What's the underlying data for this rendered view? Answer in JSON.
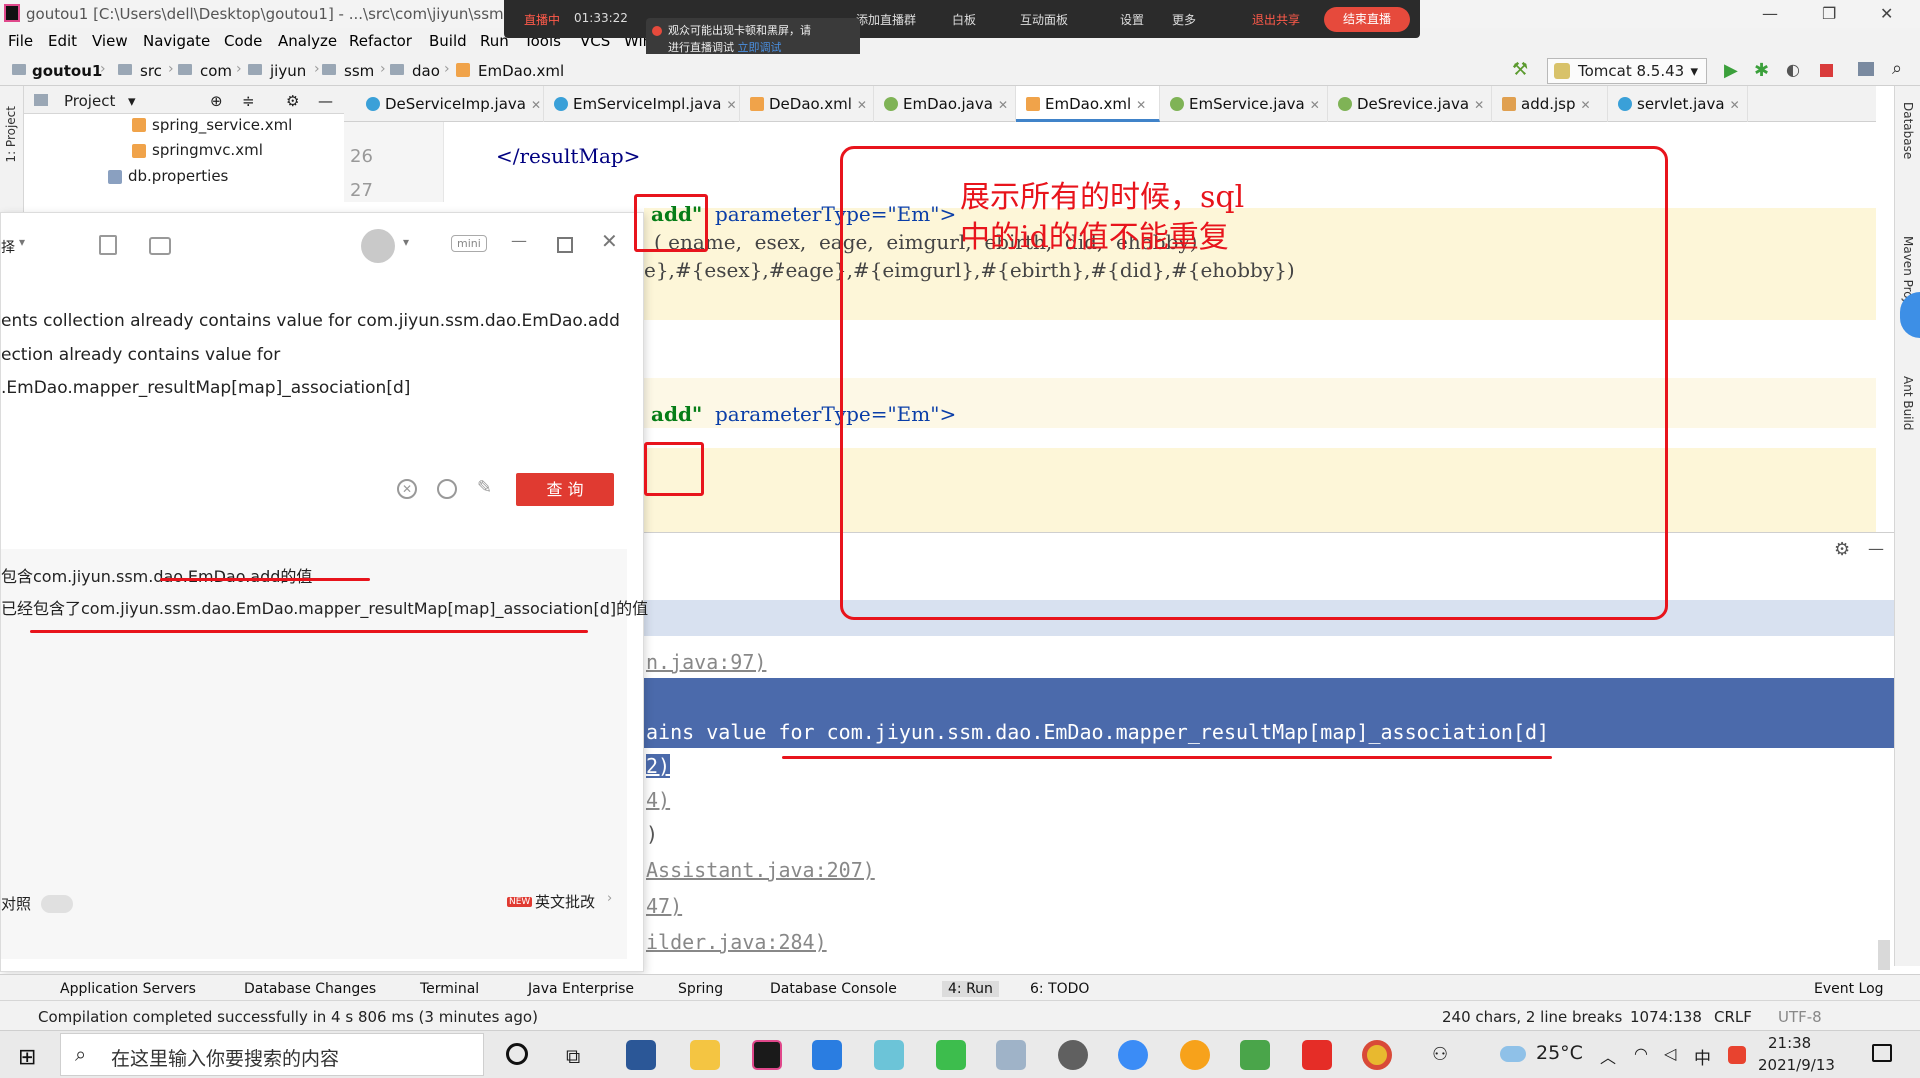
{
  "window": {
    "title": "goutou1 [C:\\Users\\dell\\Desktop\\goutou1] - ...\\src\\com\\jiyun\\ssm",
    "app_icon": "intellij-icon"
  },
  "live_bar": {
    "status": "直播中",
    "time": "01:33:22",
    "tip_line1": "观众可能出现卡顿和黑屏，请",
    "tip_line2": "进行直播调试",
    "tip_link": "立即调试",
    "items": [
      "添加直播群",
      "白板",
      "互动面板",
      "设置",
      "更多"
    ],
    "exit_share": "退出共享",
    "end_live": "结束直播"
  },
  "menu": [
    "File",
    "Edit",
    "View",
    "Navigate",
    "Code",
    "Analyze",
    "Refactor",
    "Build",
    "Run",
    "Tools",
    "VCS",
    "Window"
  ],
  "breadcrumb": [
    "goutou1",
    "src",
    "com",
    "jiyun",
    "ssm",
    "dao",
    "EmDao.xml"
  ],
  "run_config": "Tomcat 8.5.43",
  "project_panel": {
    "title": "Project",
    "items": [
      "spring_service.xml",
      "springmvc.xml",
      "db.properties"
    ]
  },
  "left_stripe_label": "1: Project",
  "tabs": [
    {
      "label": "DeServiceImp.java",
      "color": "#3aa0d8"
    },
    {
      "label": "EmServiceImpl.java",
      "color": "#3aa0d8"
    },
    {
      "label": "DeDao.xml",
      "color": "#f0a34a"
    },
    {
      "label": "EmDao.java",
      "color": "#7fb356"
    },
    {
      "label": "EmDao.xml",
      "color": "#f0a34a",
      "active": true
    },
    {
      "label": "EmService.java",
      "color": "#7fb356"
    },
    {
      "label": "DeSrevice.java",
      "color": "#7fb356"
    },
    {
      "label": "add.jsp",
      "color": "#e0a050"
    },
    {
      "label": "servlet.java",
      "color": "#3aa0d8"
    }
  ],
  "editor": {
    "line_numbers": [
      "26",
      "27"
    ],
    "line26": "</resultMap>",
    "insert1_id": "add\"",
    "param1": "parameterType=\"Em\">",
    "cols_line": "( ename,  esex,  eage,  eimgurl,  ebirth,  did,  ehobby)",
    "vals_line": "e},#{esex},#eage},#{eimgurl},#{ebirth},#{did},#{ehobby})",
    "insert2_id": "add\"",
    "param2": "parameterType=\"Em\">"
  },
  "annotation_note": "展示所有的时候，sql\n中的id的值不能重复",
  "popup": {
    "mode_label": "择",
    "mini_label": "mini",
    "input_line1": "ents collection already contains value for com.jiyun.ssm.dao.EmDao.add",
    "input_line2": "ection already contains value for",
    "input_line3": ".EmDao.mapper_resultMap[map]_association[d]",
    "query_button": "查 询",
    "result_line1": "包含com.jiyun.ssm.dao.EmDao.add的值",
    "result_line2": "已经包含了com.jiyun.ssm.dao.EmDao.mapper_resultMap[map]_association[d]的值",
    "compare_label": "对照",
    "new_badge": "NEW",
    "english_review": "英文批改"
  },
  "run_output": {
    "lines": [
      {
        "text": "n.java:97)",
        "style": "link"
      },
      {
        "text": "ains value for com.jiyun.ssm.dao.EmDao.mapper_resultMap[map]_association[d]",
        "style": "sel"
      },
      {
        "text": "2)",
        "style": "sel"
      },
      {
        "text": "4)",
        "style": "link"
      },
      {
        "text": ")",
        "style": "plain"
      },
      {
        "text": "Assistant.java:207)",
        "style": "link"
      },
      {
        "text": "47)",
        "style": "link"
      },
      {
        "text": "ilder.java:284)",
        "style": "link"
      }
    ]
  },
  "right_stripe": [
    "Database",
    "Maven Projects",
    "Ant Build"
  ],
  "bottom_tools": [
    "Application Servers",
    "Database Changes",
    "Terminal",
    "Java Enterprise",
    "Spring",
    "Database Console",
    "4: Run",
    "6: TODO",
    "Event Log"
  ],
  "status": {
    "message": "Compilation completed successfully in 4 s 806 ms (3 minutes ago)",
    "chars": "240 chars, 2 line breaks",
    "position": "1074:138",
    "line_sep": "CRLF",
    "encoding": "UTF-8"
  },
  "taskbar": {
    "search_placeholder": "在这里输入你要搜索的内容",
    "weather": "25°C",
    "ime": "中",
    "time": "21:38",
    "date": "2021/9/13"
  }
}
